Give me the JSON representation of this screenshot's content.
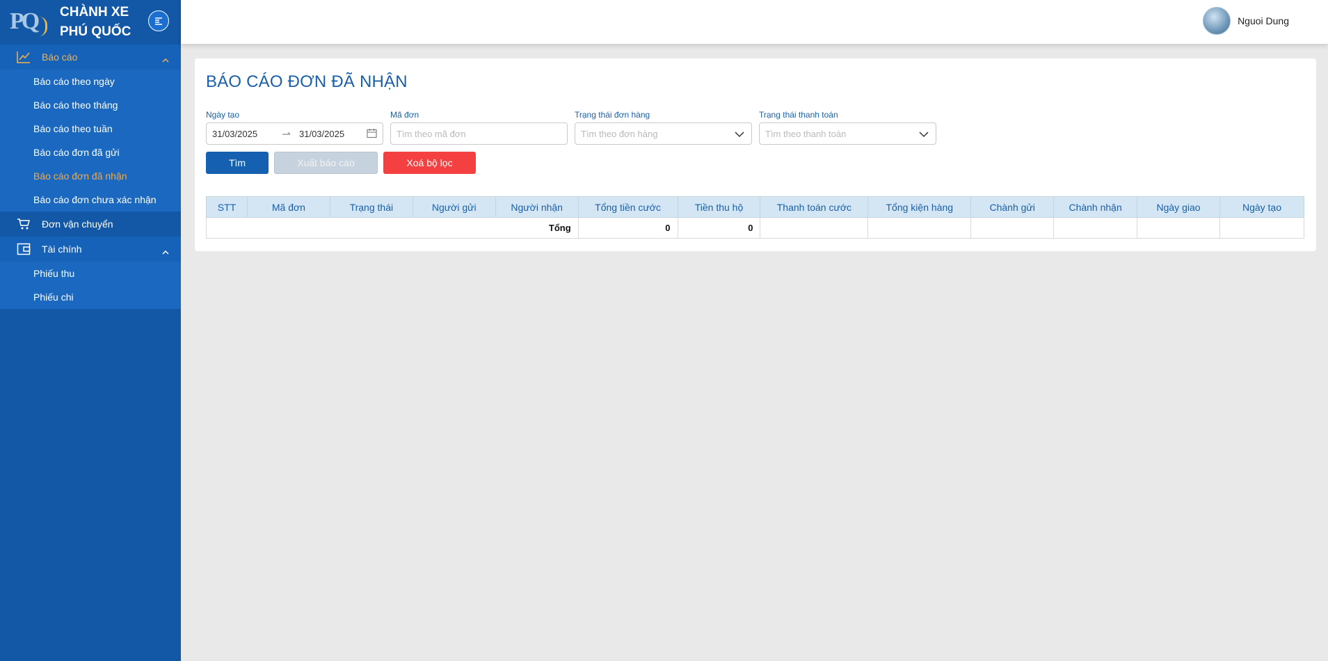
{
  "sidebar": {
    "brand_line1": "CHÀNH XE",
    "brand_line2": "PHÚ QUỐC",
    "logo_text": "PQ",
    "groups": [
      {
        "label": "Báo cáo",
        "icon": "line-chart-icon",
        "expanded": true,
        "items": [
          {
            "label": "Báo cáo theo ngày"
          },
          {
            "label": "Báo cáo theo tháng"
          },
          {
            "label": "Báo cáo theo tuần"
          },
          {
            "label": "Báo cáo đơn đã gửi"
          },
          {
            "label": "Báo cáo đơn đã nhận"
          },
          {
            "label": "Báo cáo đơn chưa xác nhận"
          }
        ]
      },
      {
        "label": "Đơn vận chuyển",
        "icon": "cart-icon"
      },
      {
        "label": "Tài chính",
        "icon": "wallet-icon",
        "expanded": true,
        "items": [
          {
            "label": "Phiếu thu"
          },
          {
            "label": "Phiếu chi"
          }
        ]
      }
    ],
    "active_color": "#f5a843",
    "bg_color": "#1258a6"
  },
  "header": {
    "user_name": "Nguoi Dung"
  },
  "main": {
    "title": "BÁO CÁO ĐƠN ĐÃ NHẬN",
    "filters": {
      "date_label": "Ngày tạo",
      "date_from": "31/03/2025",
      "date_to": "31/03/2025",
      "code_label": "Mã đơn",
      "code_placeholder": "Tìm theo mã đơn",
      "order_status_label": "Trạng thái đơn hàng",
      "order_status_placeholder": "Tìm theo đơn hàng",
      "payment_status_label": "Trạng thái thanh toán",
      "payment_status_placeholder": "Tìm theo thanh toán"
    },
    "buttons": {
      "find": "Tìm",
      "export": "Xuất báo cáo",
      "clear": "Xoá bộ lọc"
    },
    "table": {
      "columns": [
        "STT",
        "Mã đơn",
        "Trạng thái",
        "Người gửi",
        "Người nhận",
        "Tổng tiền cước",
        "Tiền thu hộ",
        "Thanh toán cước",
        "Tổng kiện hàng",
        "Chành gửi",
        "Chành nhận",
        "Ngày giao",
        "Ngày tạo"
      ],
      "total_label": "Tổng",
      "total_fee": "0",
      "total_cod": "0"
    }
  }
}
